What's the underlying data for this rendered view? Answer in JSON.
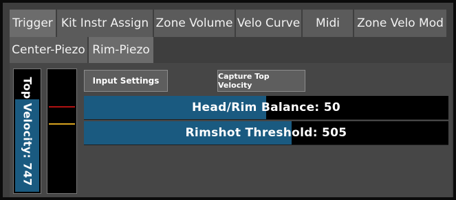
{
  "tabs": [
    {
      "label": "Trigger",
      "active": true
    },
    {
      "label": "Kit Instr Assign",
      "active": false
    },
    {
      "label": "Zone Volume",
      "active": false
    },
    {
      "label": "Velo Curve",
      "active": false
    },
    {
      "label": "Midi",
      "active": false
    },
    {
      "label": "Zone Velo Mod",
      "active": false
    }
  ],
  "sub_tabs": [
    {
      "label": "Center-Piezo",
      "active": false
    },
    {
      "label": "Rim-Piezo",
      "active": true
    }
  ],
  "top_velocity": {
    "label": "Top Velocity: 747",
    "fill_fraction": 0.77
  },
  "meter": {
    "indicator_colors": [
      "#b31212",
      "#d9a520"
    ],
    "indicator_levels": [
      0.69,
      0.55
    ]
  },
  "buttons": {
    "input_settings": "Input Settings",
    "capture_top_velocity": "Capture Top Velocity"
  },
  "sliders": {
    "head_rim_balance": {
      "label": "Head/Rim Balance: 50",
      "fill_fraction": 0.5
    },
    "rimshot_threshold": {
      "label": "Rimshot Threshold: 505",
      "fill_fraction": 0.57
    }
  },
  "colors": {
    "accent_fill": "#1a5a80",
    "panel_bg": "#464646",
    "tab_bg": "#5b5b5b"
  }
}
